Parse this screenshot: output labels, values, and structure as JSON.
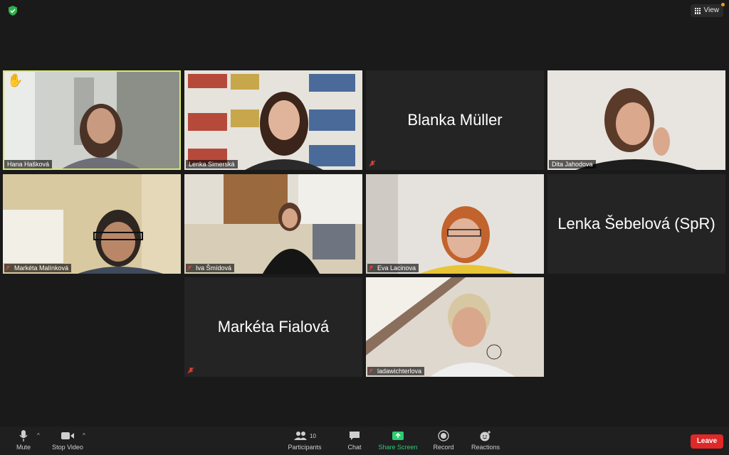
{
  "header": {
    "view_label": "View"
  },
  "participants": [
    {
      "name": "Hana Hašková",
      "video": true,
      "muted": false,
      "hand_raised": true,
      "active": true
    },
    {
      "name": "Lenka Simerská",
      "video": true,
      "muted": false
    },
    {
      "name": "Blanka Müller",
      "video": false,
      "muted": true
    },
    {
      "name": "Dita Jahodova",
      "video": true,
      "muted": false
    },
    {
      "name": "Markéta Malínková",
      "video": true,
      "muted": true
    },
    {
      "name": "Iva Šmídová",
      "video": true,
      "muted": true
    },
    {
      "name": "Eva Lacinova",
      "video": true,
      "muted": true
    },
    {
      "name": "Lenka Šebelová (SpR)",
      "video": false,
      "muted": false
    },
    {
      "name": "Markéta Fialová",
      "video": false,
      "muted": true
    },
    {
      "name": "ladawichterlova",
      "video": true,
      "muted": true
    }
  ],
  "toolbar": {
    "mute": "Mute",
    "stop_video": "Stop Video",
    "participants": "Participants",
    "participants_count": "10",
    "chat": "Chat",
    "share_screen": "Share Screen",
    "record": "Record",
    "reactions": "Reactions",
    "leave": "Leave"
  },
  "colors": {
    "background": "#1a1a1a",
    "tile": "#242424",
    "active_speaker": "#d7e96b",
    "share_green": "#2ecc71",
    "leave_red": "#e02828"
  },
  "icons": [
    "shield-check-icon",
    "grid-icon",
    "raised-hand-icon",
    "mic-off-icon",
    "mic-icon",
    "video-icon",
    "participants-icon",
    "chat-icon",
    "share-screen-icon",
    "record-icon",
    "reactions-icon"
  ]
}
